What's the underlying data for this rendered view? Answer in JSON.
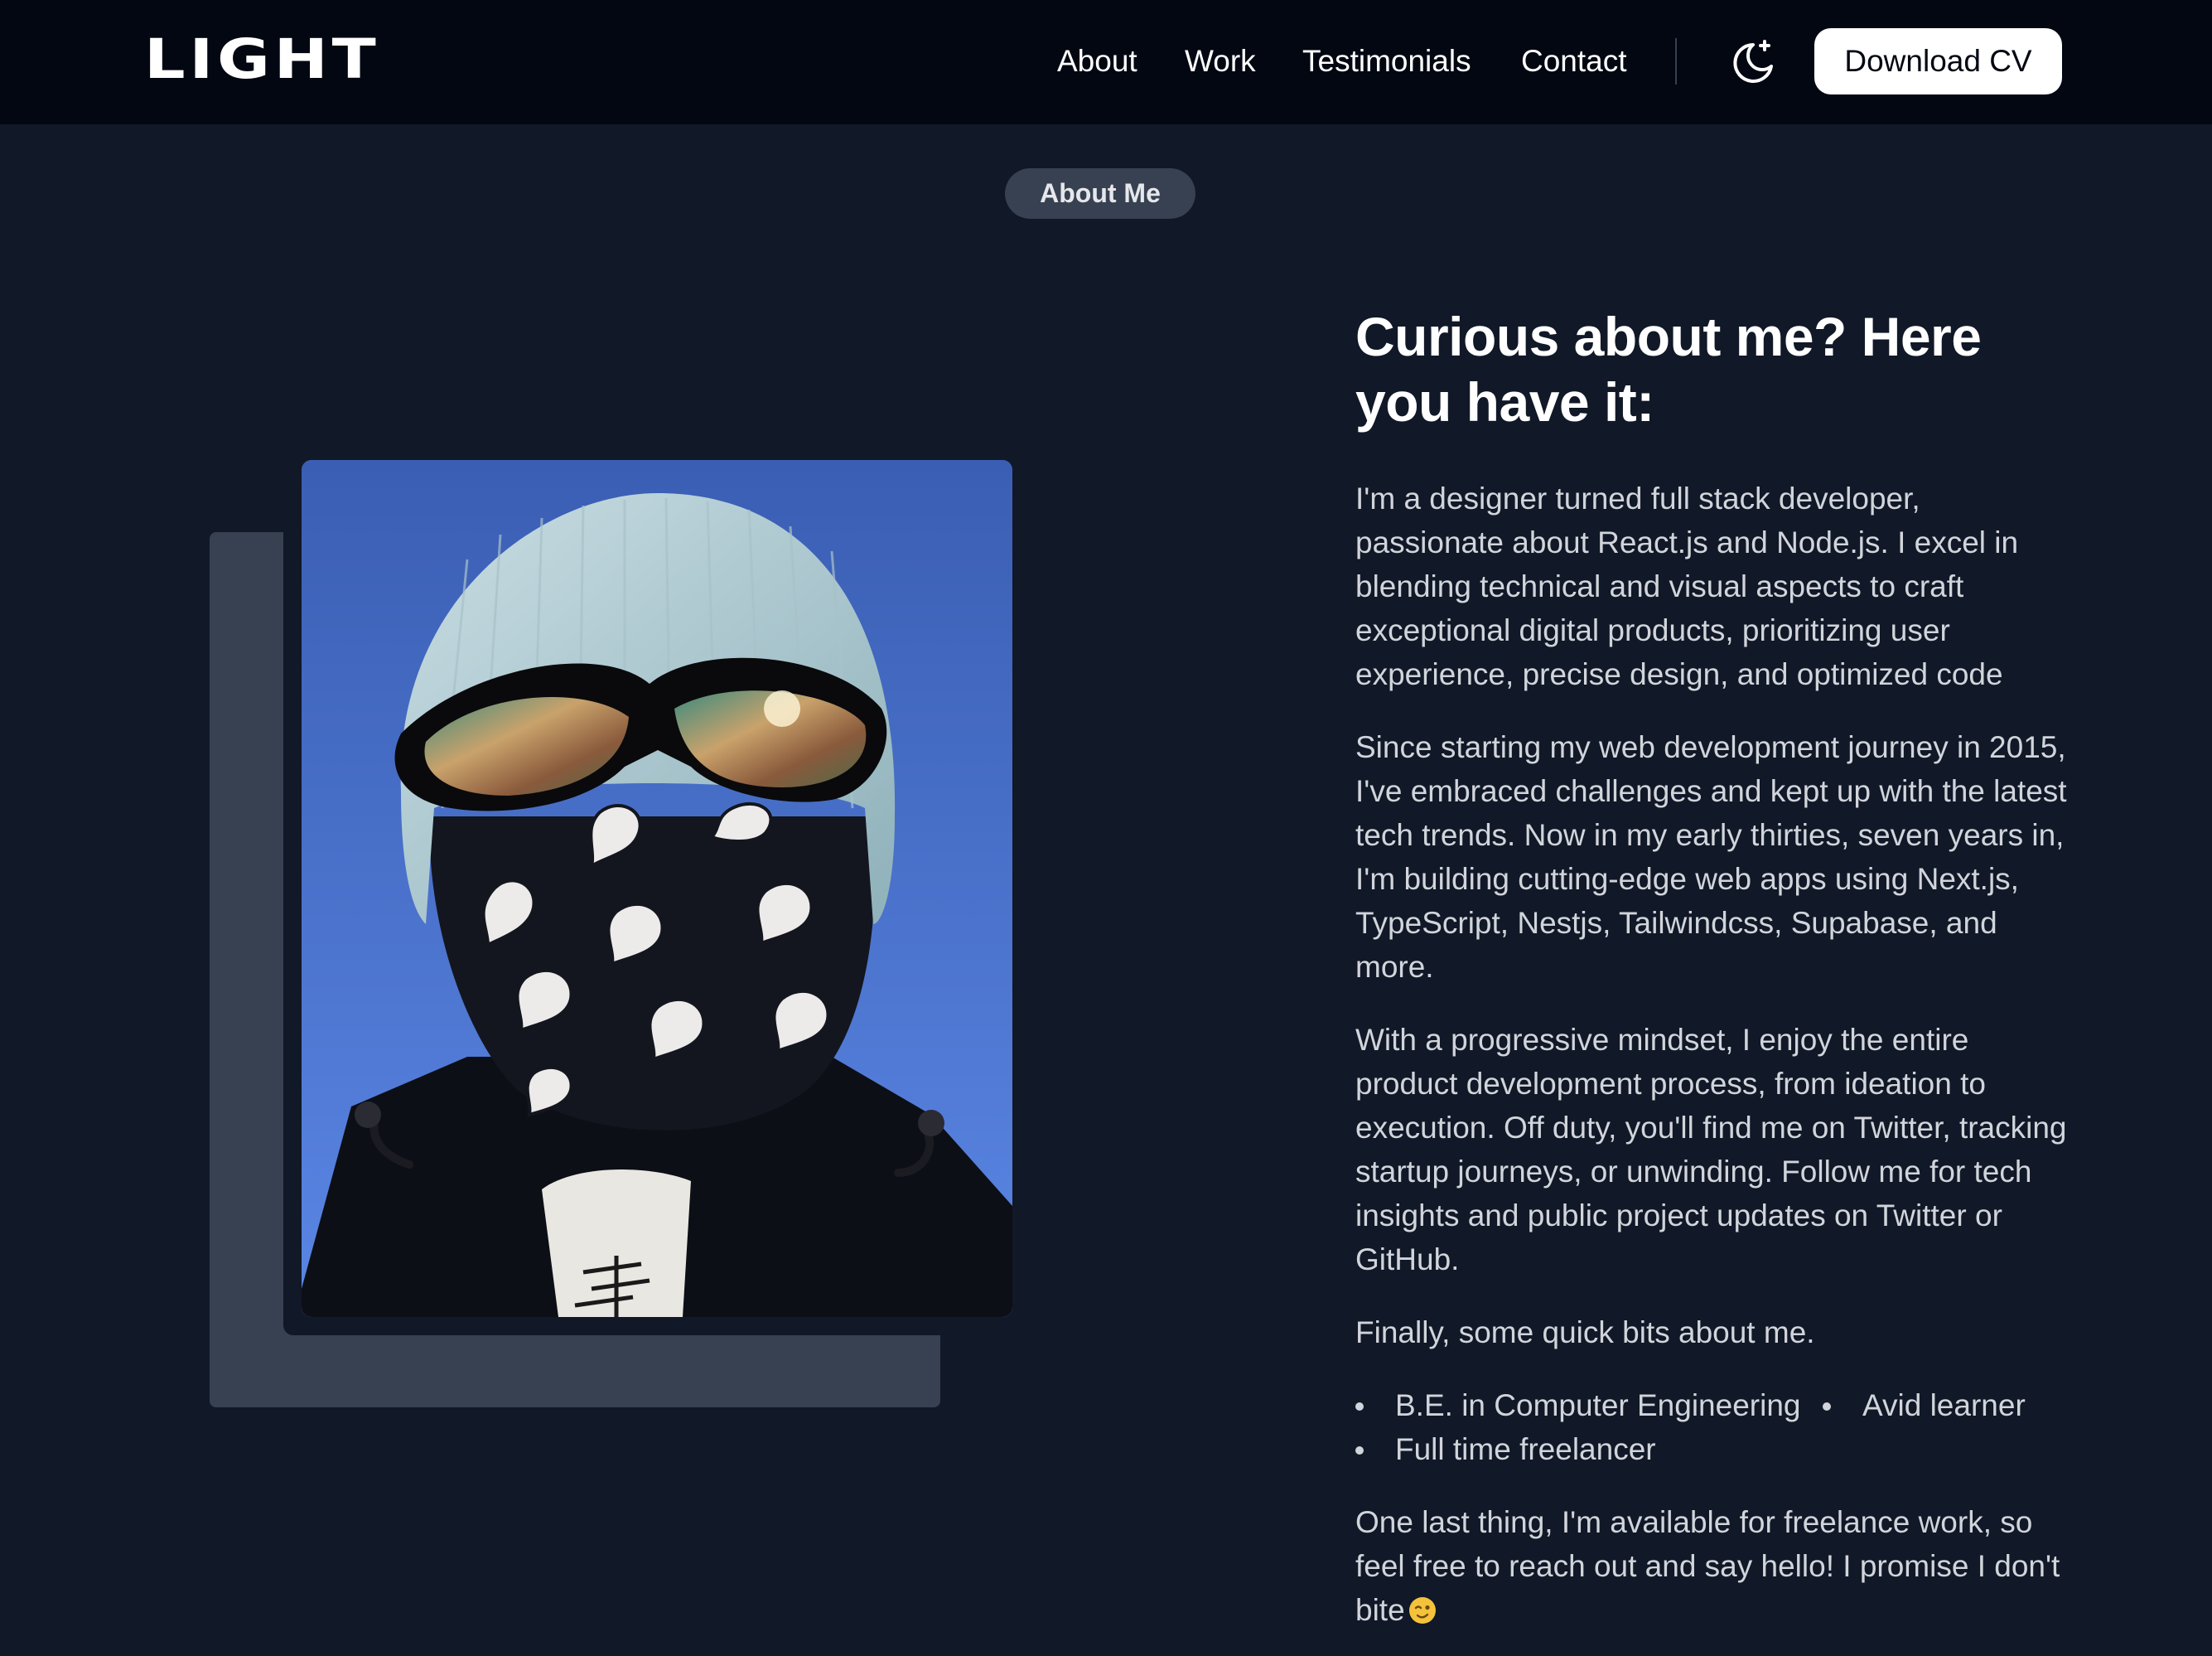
{
  "header": {
    "logo": "LIGHT",
    "nav": [
      "About",
      "Work",
      "Testimonials",
      "Contact"
    ],
    "theme_icon": "moon-sparkle-icon",
    "cta_label": "Download CV"
  },
  "about": {
    "badge": "About Me",
    "heading": "Curious about me? Here you have it:",
    "paragraphs": [
      "I'm a designer turned full stack developer, passionate about React.js and Node.js. I excel in blending technical and visual aspects to craft exceptional digital products, prioritizing user experience, precise design, and optimized code",
      "Since starting my web development journey in 2015, I've embraced challenges and kept up with the latest tech trends. Now in my early thirties, seven years in, I'm building cutting-edge web apps using Next.js, TypeScript, Nestjs, Tailwindcss, Supabase, and more.",
      "With a progressive mindset, I enjoy the entire product development process, from ideation to execution. Off duty, you'll find me on Twitter, tracking startup journeys, or unwinding. Follow me for tech insights and public project updates on Twitter or GitHub.",
      "Finally, some quick bits about me."
    ],
    "bits": [
      "B.E. in Computer Engineering",
      "Avid learner",
      "Full time freelancer"
    ],
    "closing": "One last thing, I'm available for freelance work, so feel free to reach out and say hello! I promise I don't bite",
    "closing_emoji": "winking-face-emoji",
    "photo_alt": "Portrait of a person wearing a light blue beanie, reflective sunglasses and a paisley bandana mask"
  },
  "colors": {
    "page_bg": "#111827",
    "header_bg": "#030712",
    "badge_bg": "#374151",
    "text_muted": "#d1d5db",
    "text_strong": "#ffffff"
  }
}
